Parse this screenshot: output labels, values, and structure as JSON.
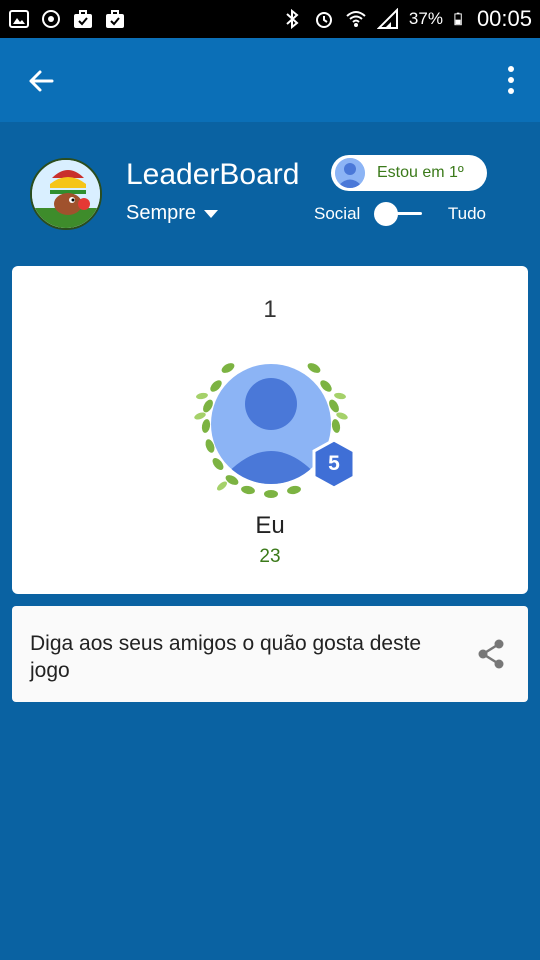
{
  "status_bar": {
    "battery": "37%",
    "time": "00:05"
  },
  "header": {
    "title": "LeaderBoard",
    "filter": "Sempre",
    "rank_pill": "Estou em 1º",
    "toggle_left": "Social",
    "toggle_right": "Tudo"
  },
  "player": {
    "rank": "1",
    "level": "5",
    "name": "Eu",
    "score": "23"
  },
  "share": {
    "text": "Diga aos seus amigos o quão gosta deste jogo"
  },
  "colors": {
    "background": "#0a62a2",
    "appbar": "#0b6fb7",
    "accent_green": "#3b7a1a",
    "level_badge": "#3f6fd6"
  },
  "icons": {
    "back": "arrow-left-icon",
    "more": "more-vert-icon",
    "share": "share-icon"
  }
}
